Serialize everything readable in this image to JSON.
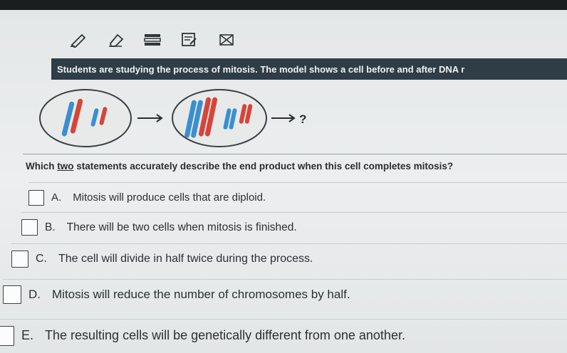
{
  "toolbar": {
    "tools": [
      {
        "icon": "pencil-icon"
      },
      {
        "icon": "eraser-icon"
      },
      {
        "icon": "highlighter-icon"
      },
      {
        "icon": "notepad-icon"
      },
      {
        "icon": "cross-out-icon"
      }
    ]
  },
  "stem": {
    "text": "Students are studying the process of mitosis. The model shows a cell before and after DNA r"
  },
  "model": {
    "arrow_label": "?",
    "colors": {
      "red": "#d6453a",
      "blue": "#3a8fd0",
      "cell_fill": "#e8eaea",
      "cell_stroke": "#3a3f42"
    }
  },
  "question": {
    "prefix": "Which ",
    "emphasis": "two",
    "suffix": " statements accurately describe the end product when this cell completes mitosis?"
  },
  "options": [
    {
      "letter": "A.",
      "text": "Mitosis will produce cells that are diploid."
    },
    {
      "letter": "B.",
      "text": "There will be two cells when mitosis is finished."
    },
    {
      "letter": "C.",
      "text": "The cell will divide in half twice during the process."
    },
    {
      "letter": "D.",
      "text": "Mitosis will reduce the number of chromosomes by half."
    },
    {
      "letter": "E.",
      "text": "The resulting cells will be genetically different from one another."
    }
  ]
}
